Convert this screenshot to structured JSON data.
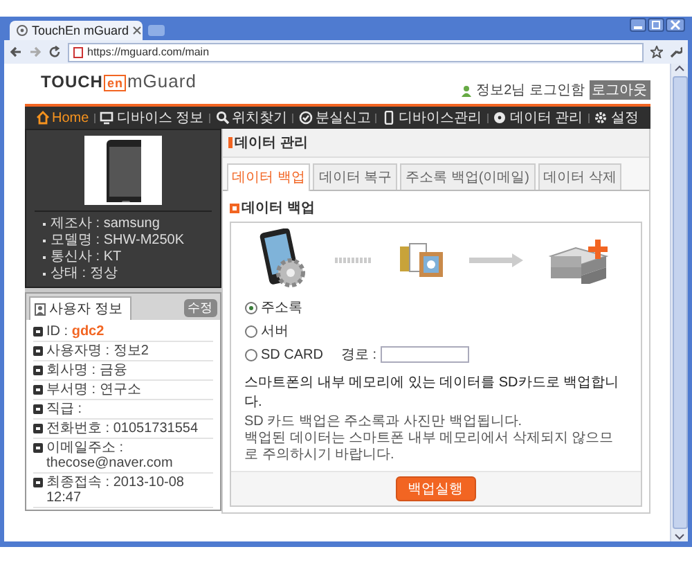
{
  "browser": {
    "tab_title": "TouchEn mGuard",
    "url": "https://mguard.com/main"
  },
  "header": {
    "logo": {
      "touch": "TOUCH",
      "en": "en",
      "product": "mGuard"
    },
    "user_greeting": "정보2님 로그인함",
    "logout_button": "로그아웃"
  },
  "nav": [
    {
      "label": "Home",
      "kind": "home",
      "selected": true
    },
    {
      "label": "디바이스 정보",
      "kind": "monitor",
      "selected": false
    },
    {
      "label": "위치찾기",
      "kind": "search",
      "selected": false
    },
    {
      "label": "분실신고",
      "kind": "check",
      "selected": false
    },
    {
      "label": "디바이스관리",
      "kind": "phone",
      "selected": false
    },
    {
      "label": "데이터 관리",
      "kind": "disc",
      "selected": false
    },
    {
      "label": "설정",
      "kind": "gear",
      "selected": false
    }
  ],
  "device": {
    "info": [
      {
        "text": "제조사 : samsung"
      },
      {
        "text": "모델명 : SHW-M250K"
      },
      {
        "text": "통신사 : KT"
      },
      {
        "text": "상태 : 정상"
      }
    ]
  },
  "user_info": {
    "title": "사용자 정보",
    "edit_button": "수정",
    "rows": [
      {
        "label": "ID :",
        "value": "gdc2",
        "highlight": true
      },
      {
        "label": "사용자명 :",
        "value": "정보2",
        "highlight": false
      },
      {
        "label": "회사명 :",
        "value": "금융",
        "highlight": false
      },
      {
        "label": "부서명 :",
        "value": "연구소",
        "highlight": false
      },
      {
        "label": "직급 :",
        "highlight": false
      },
      {
        "label": "전화번호 :",
        "value": "01051731554",
        "highlight": false
      },
      {
        "label": "이메일주소 :",
        "value": "thecose@naver.com",
        "highlight": false
      },
      {
        "label": "최종접속 :",
        "value": "2013-10-08 12:47",
        "highlight": false
      }
    ]
  },
  "content": {
    "title": "데이터 관리",
    "tabs": [
      {
        "label": "데이터 백업",
        "selected": true
      },
      {
        "label": "데이터 복구",
        "selected": false
      },
      {
        "label": "주소록 백업(이메일)",
        "selected": false
      },
      {
        "label": "데이터 삭제",
        "selected": false
      }
    ],
    "section_title": "데이터 백업",
    "options": [
      {
        "label": "주소록",
        "selected": true
      },
      {
        "label": "서버",
        "selected": false
      },
      {
        "label": "SD CARD",
        "selected": false,
        "path_label": "경로 :"
      }
    ],
    "description": "스마트폰의 내부 메모리에 있는 데이터를 SD카드로 백업합니다.",
    "notes": [
      "SD 카드 백업은 주소록과 사진만 백업됩니다.",
      "백업된 데이터는 스마트폰 내부 메모리에서 삭제되지 않으므로 주의하시기 바랍니다."
    ],
    "run_button": "백업실행"
  }
}
